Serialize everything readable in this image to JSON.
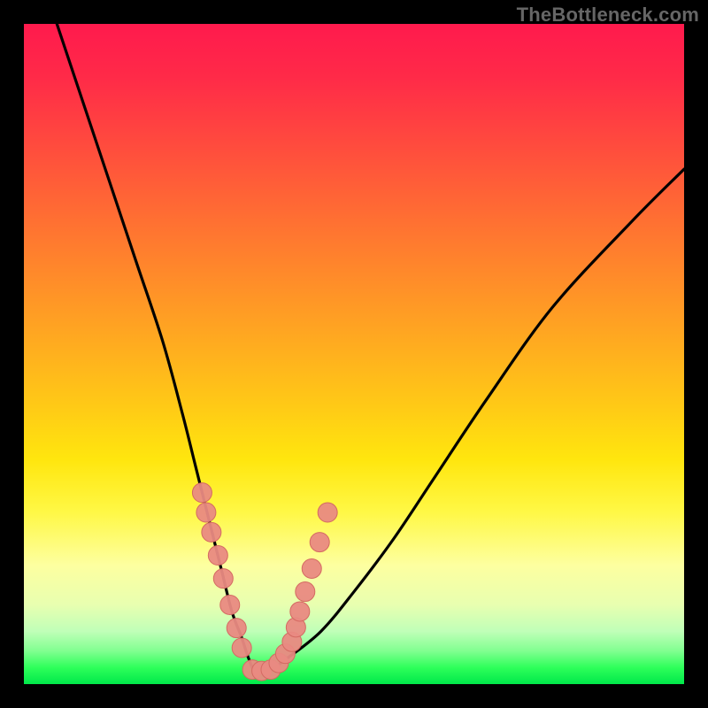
{
  "watermark": "TheBottleneck.com",
  "chart_data": {
    "type": "line",
    "title": "",
    "xlabel": "",
    "ylabel": "",
    "xlim": [
      0,
      100
    ],
    "ylim": [
      0,
      100
    ],
    "grid": false,
    "legend": false,
    "background": "red-yellow-green vertical gradient",
    "series": [
      {
        "name": "bottleneck-curve",
        "color": "#000000",
        "x": [
          5,
          9,
          13,
          17,
          21,
          24,
          26,
          28,
          30,
          31.5,
          33,
          34,
          35,
          37,
          40,
          45,
          50,
          56,
          62,
          70,
          80,
          92,
          100
        ],
        "y": [
          100,
          88,
          76,
          64,
          52,
          41,
          33,
          25,
          17,
          11,
          7,
          4,
          2,
          2,
          4,
          8,
          14,
          22,
          31,
          43,
          57,
          70,
          78
        ]
      }
    ],
    "markers": [
      {
        "name": "highlight-points",
        "shape": "circle",
        "fill": "#e98a82",
        "stroke": "#d46a62",
        "radius_px": 11,
        "x": [
          27.0,
          27.6,
          28.4,
          29.4,
          30.2,
          31.2,
          32.2,
          33.0,
          34.6,
          36.0,
          37.4,
          38.6,
          39.6,
          40.6,
          41.2,
          41.8,
          42.6,
          43.6,
          44.8,
          46.0
        ],
        "y": [
          29.0,
          26.0,
          23.0,
          19.5,
          16.0,
          12.0,
          8.5,
          5.5,
          2.2,
          2.0,
          2.2,
          3.2,
          4.6,
          6.4,
          8.6,
          11.0,
          14.0,
          17.5,
          21.5,
          26.0
        ]
      }
    ]
  }
}
